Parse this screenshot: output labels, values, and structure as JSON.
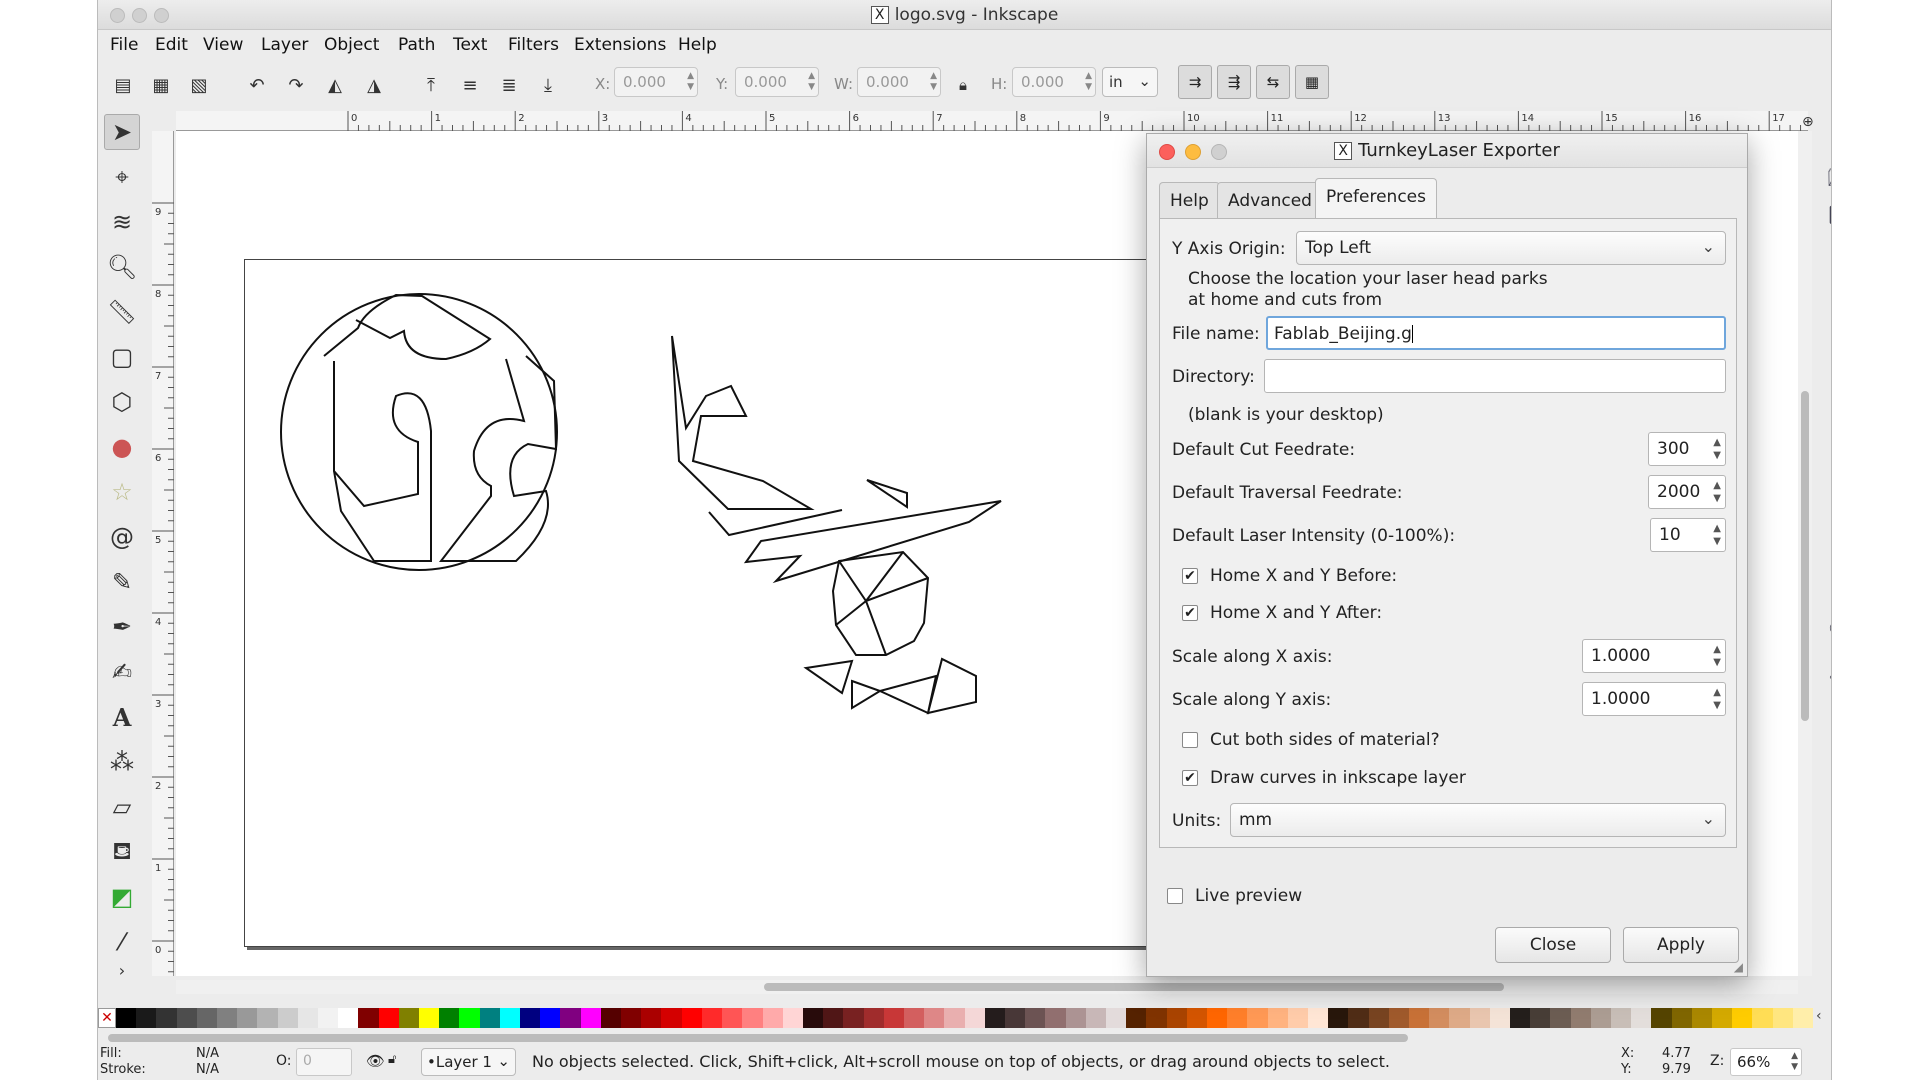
{
  "window": {
    "title": "logo.svg - Inkscape",
    "x_icon": "X"
  },
  "menu": [
    "File",
    "Edit",
    "View",
    "Layer",
    "Object",
    "Path",
    "Text",
    "Filters",
    "Extensions",
    "Help"
  ],
  "toolbar": {
    "x_label": "X:",
    "x_value": "0.000",
    "y_label": "Y:",
    "y_value": "0.000",
    "w_label": "W:",
    "w_value": "0.000",
    "h_label": "H:",
    "h_value": "0.000",
    "units": "in"
  },
  "ruler_h_labels": [
    "0",
    "1",
    "2",
    "3",
    "4",
    "5",
    "6",
    "7",
    "8",
    "9",
    "10",
    "11",
    "12",
    "13",
    "14",
    "15",
    "16",
    "17"
  ],
  "ruler_v_labels": [
    "9",
    "8",
    "7",
    "6",
    "5",
    "4",
    "3",
    "2",
    "1",
    "0"
  ],
  "dialog": {
    "title": "TurnkeyLaser Exporter",
    "tabs": [
      "Help",
      "Advanced",
      "Preferences"
    ],
    "y_axis_label": "Y Axis Origin:",
    "y_axis_value": "Top Left",
    "y_axis_help_1": "Choose the location your laser head parks",
    "y_axis_help_2": "at home and cuts from",
    "file_name_label": "File name:",
    "file_name_value": "Fablab_Beijing.g",
    "directory_label": "Directory:",
    "directory_value": "",
    "directory_help": "(blank is your desktop)",
    "cut_feed_label": "Default Cut Feedrate:",
    "cut_feed_value": "300",
    "trav_feed_label": "Default Traversal Feedrate:",
    "trav_feed_value": "2000",
    "intensity_label": "Default Laser Intensity (0-100%):",
    "intensity_value": "10",
    "home_before_label": "Home X and Y Before:",
    "home_before_checked": true,
    "home_after_label": "Home X and Y After:",
    "home_after_checked": true,
    "scale_x_label": "Scale along X axis:",
    "scale_x_value": "1.0000",
    "scale_y_label": "Scale along Y axis:",
    "scale_y_value": "1.0000",
    "cut_both_label": "Cut both sides of material?",
    "cut_both_checked": false,
    "draw_curves_label": "Draw curves in inkscape layer",
    "draw_curves_checked": true,
    "units_label": "Units:",
    "units_value": "mm",
    "live_preview_label": "Live preview",
    "live_preview_checked": false,
    "close_label": "Close",
    "apply_label": "Apply"
  },
  "status": {
    "fill_label": "Fill:",
    "fill_value": "N/A",
    "stroke_label": "Stroke:",
    "stroke_value": "N/A",
    "opacity_label": "O:",
    "opacity_value": "0",
    "layer": "•Layer 1",
    "message": "No objects selected. Click, Shift+click, Alt+scroll mouse on top of objects, or drag around objects to select.",
    "x_label": "X:",
    "x_value": "4.77",
    "y_label": "Y:",
    "y_value": "9.79",
    "z_label": "Z:",
    "zoom": "66%"
  },
  "palette": [
    "#000000",
    "#1a1a1a",
    "#333333",
    "#4d4d4d",
    "#666666",
    "#808080",
    "#999999",
    "#b3b3b3",
    "#cccccc",
    "#e6e6e6",
    "#f2f2f2",
    "#ffffff",
    "#800000",
    "#ff0000",
    "#808000",
    "#ffff00",
    "#008000",
    "#00ff00",
    "#008080",
    "#00ffff",
    "#000080",
    "#0000ff",
    "#800080",
    "#ff00ff",
    "#550000",
    "#800000",
    "#aa0000",
    "#d40000",
    "#ff0000",
    "#ff2a2a",
    "#ff5555",
    "#ff8080",
    "#ffaaaa",
    "#ffd5d5",
    "#280b0b",
    "#501616",
    "#782121",
    "#a02c2c",
    "#c83737",
    "#d35f5f",
    "#de8787",
    "#e9afaf",
    "#f4d7d7",
    "#241c1c",
    "#483737",
    "#6c5353",
    "#916f6f",
    "#ac9393",
    "#c8b7b7",
    "#e3dbdb",
    "#552200",
    "#803300",
    "#aa4400",
    "#d45500",
    "#ff6600",
    "#ff7f2a",
    "#ff9955",
    "#ffb380",
    "#ffccaa",
    "#ffe6d5",
    "#28170b",
    "#502d16",
    "#784421",
    "#a05a2c",
    "#c87137",
    "#d38d5f",
    "#deaa87",
    "#e9c6af",
    "#f4e3d7",
    "#241f1c",
    "#483e37",
    "#6c5d53",
    "#917c6f",
    "#ac9d93",
    "#c8beb7",
    "#e3dedb",
    "#554400",
    "#806600",
    "#aa8800",
    "#d4aa00",
    "#ffcc00",
    "#ffdd55",
    "#ffe680",
    "#ffeeaa"
  ]
}
